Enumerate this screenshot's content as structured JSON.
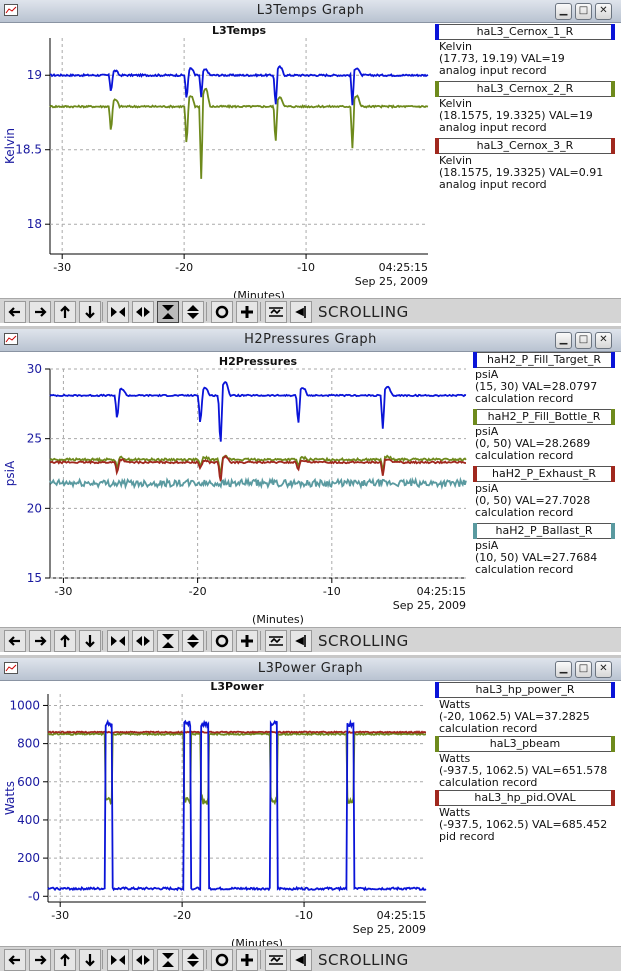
{
  "windows": [
    {
      "title": "L3Temps Graph",
      "plot_title": "L3Temps",
      "ylabel": "Kelvin",
      "xlabel": "(Minutes)",
      "time": "04:25:15",
      "date": "Sep 25, 2009",
      "yticks": [
        "19",
        "18.5",
        "18"
      ],
      "xticks": [
        "-30",
        "-20",
        "-10"
      ],
      "legend": [
        {
          "name": "haL3_Cernox_1_R",
          "color": "#0a14d8",
          "unit": "Kelvin",
          "info": "(17.73, 19.19) VAL=19",
          "record": "analog input record"
        },
        {
          "name": "haL3_Cernox_2_R",
          "color": "#6e8a1c",
          "unit": "Kelvin",
          "info": "(18.1575, 19.3325) VAL=19",
          "record": "analog input record"
        },
        {
          "name": "haL3_Cernox_3_R",
          "color": "#a0281e",
          "unit": "Kelvin",
          "info": "(18.1575, 19.3325)  VAL=0.91",
          "record": "analog input record"
        }
      ],
      "chart_data": {
        "type": "line",
        "title": "L3Temps",
        "xlabel": "(Minutes)",
        "ylabel": "Kelvin",
        "xlim": [
          -31,
          0
        ],
        "ylim": [
          17.8,
          19.25
        ],
        "series": [
          {
            "name": "haL3_Cernox_1_R",
            "base": 19.0,
            "noise": 0.006,
            "spikes": [
              [
                -26,
                -0.12
              ],
              [
                -19.8,
                -0.18
              ],
              [
                -18.6,
                -0.15
              ],
              [
                -12.5,
                -0.22
              ],
              [
                -6.2,
                -0.2
              ]
            ]
          },
          {
            "name": "haL3_Cernox_2_R",
            "base": 18.79,
            "noise": 0.006,
            "spikes": [
              [
                -26,
                -0.18
              ],
              [
                -19.8,
                -0.28
              ],
              [
                -18.6,
                -0.48
              ],
              [
                -12.5,
                -0.26
              ],
              [
                -6.2,
                -0.28
              ]
            ]
          }
        ]
      }
    },
    {
      "title": "H2Pressures Graph",
      "plot_title": "H2Pressures",
      "ylabel": "psiA",
      "xlabel": "(Minutes)",
      "time": "04:25:15",
      "date": "Sep 25, 2009",
      "yticks": [
        "30",
        "25",
        "20",
        "15"
      ],
      "xticks": [
        "-30",
        "-20",
        "-10"
      ],
      "legend": [
        {
          "name": "haH2_P_Fill_Target_R",
          "color": "#0a14d8",
          "unit": "psiA",
          "info": "(15, 30) VAL=28.0797",
          "record": "calculation record"
        },
        {
          "name": "haH2_P_Fill_Bottle_R",
          "color": "#6e8a1c",
          "unit": "psiA",
          "info": "(0, 50) VAL=28.2689",
          "record": "calculation record"
        },
        {
          "name": "haH2_P_Exhaust_R",
          "color": "#a0281e",
          "unit": "psiA",
          "info": "(0, 50) VAL=27.7028",
          "record": "calculation record"
        },
        {
          "name": "haH2_P_Ballast_R",
          "color": "#5a9aa0",
          "unit": "psiA",
          "info": "(10, 50) VAL=27.7684",
          "record": "calculation record"
        }
      ],
      "chart_data": {
        "type": "line",
        "title": "H2Pressures",
        "xlabel": "(Minutes)",
        "ylabel": "psiA",
        "xlim": [
          -31,
          0
        ],
        "ylim": [
          15,
          30
        ],
        "series": [
          {
            "name": "haH2_P_Fill_Target_R",
            "base": 28.1,
            "noise": 0.05,
            "spikes": [
              [
                -26,
                -1.9
              ],
              [
                -19.8,
                -2.2
              ],
              [
                -18.3,
                -4.0
              ],
              [
                -12.5,
                -2.2
              ],
              [
                -6.2,
                -2.4
              ]
            ]
          },
          {
            "name": "haH2_P_Fill_Bottle_R",
            "base": 23.5,
            "noise": 0.08,
            "spikes": [
              [
                -26,
                -0.6
              ],
              [
                -19.8,
                -0.6
              ],
              [
                -18.3,
                -1.2
              ],
              [
                -12.5,
                -0.5
              ],
              [
                -6.2,
                -0.8
              ]
            ]
          },
          {
            "name": "haH2_P_Exhaust_R",
            "base": 23.3,
            "noise": 0.06,
            "spikes": [
              [
                -26,
                -0.8
              ],
              [
                -19.8,
                -0.5
              ],
              [
                -18.3,
                -1.6
              ],
              [
                -12.5,
                -0.6
              ],
              [
                -6.2,
                -1.0
              ]
            ]
          },
          {
            "name": "haH2_P_Ballast_R",
            "base": 21.8,
            "noise": 0.25,
            "spikes": []
          }
        ]
      }
    },
    {
      "title": "L3Power Graph",
      "plot_title": "L3Power",
      "ylabel": "Watts",
      "xlabel": "(Minutes)",
      "time": "04:25:15",
      "date": "Sep 25, 2009",
      "yticks": [
        "1000",
        "800",
        "600",
        "400",
        "200",
        "-0"
      ],
      "xticks": [
        "-30",
        "-20",
        "-10"
      ],
      "legend": [
        {
          "name": "haL3_hp_power_R",
          "color": "#0a14d8",
          "unit": "Watts",
          "info": "(-20, 1062.5) VAL=37.2825",
          "record": "calculation record"
        },
        {
          "name": "haL3_pbeam",
          "color": "#6e8a1c",
          "unit": "Watts",
          "info": "(-937.5, 1062.5) VAL=651.578",
          "record": "calculation record"
        },
        {
          "name": "haL3_hp_pid.OVAL",
          "color": "#a0281e",
          "unit": "Watts",
          "info": "(-937.5, 1062.5) VAL=685.452",
          "record": "pid record"
        }
      ],
      "chart_data": {
        "type": "line",
        "title": "L3Power",
        "xlabel": "(Minutes)",
        "ylabel": "Watts",
        "xlim": [
          -31,
          0
        ],
        "ylim": [
          -30,
          1060
        ],
        "series": [
          {
            "name": "haL3_pbeam",
            "base": 850,
            "noise": 4,
            "pulses": [
              [
                -26.3,
                -25.7
              ],
              [
                -19.9,
                -19.3
              ],
              [
                -18.5,
                -17.8
              ],
              [
                -12.8,
                -12.2
              ],
              [
                -6.5,
                -5.9
              ]
            ],
            "low": 500
          },
          {
            "name": "haL3_hp_pid.OVAL",
            "base": 860,
            "noise": 3,
            "pulses": []
          },
          {
            "name": "haL3_hp_power_R",
            "base": 40,
            "noise": 6,
            "pulses": [
              [
                -26.3,
                -25.7
              ],
              [
                -19.9,
                -19.3
              ],
              [
                -18.5,
                -17.8
              ],
              [
                -12.8,
                -12.2
              ],
              [
                -6.5,
                -5.9
              ]
            ],
            "high": 920
          }
        ]
      }
    }
  ],
  "toolbar": {
    "scrolling_label": "SCROLLING"
  }
}
